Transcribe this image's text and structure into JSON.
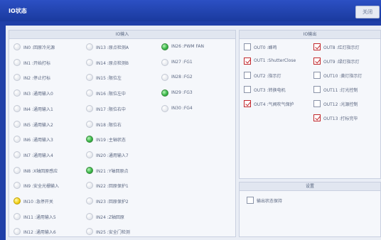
{
  "window": {
    "title": "IO状态",
    "close_label": "关闭"
  },
  "inputs_panel": {
    "title": "IO输入",
    "items": [
      {
        "label": "IN0 :回原冷光源",
        "state": "off"
      },
      {
        "label": "IN1 :开始打标",
        "state": "off"
      },
      {
        "label": "IN2 :停止打标",
        "state": "off"
      },
      {
        "label": "IN3 :通用输入0",
        "state": "off"
      },
      {
        "label": "IN4 :通用输入1",
        "state": "off"
      },
      {
        "label": "IN5 :通用输入2",
        "state": "off"
      },
      {
        "label": "IN6 :通用输入3",
        "state": "off"
      },
      {
        "label": "IN7 :通用输入4",
        "state": "off"
      },
      {
        "label": "IN8 :X轴回原感应",
        "state": "off"
      },
      {
        "label": "IN9 :安全光栅输入",
        "state": "off"
      },
      {
        "label": "IN10 :急停开关",
        "state": "yellow"
      },
      {
        "label": "IN11 :通用输入5",
        "state": "off"
      },
      {
        "label": "IN12 :通用输入6",
        "state": "off"
      },
      {
        "label": "IN13 :原点检测A",
        "state": "off"
      },
      {
        "label": "IN14 :原点检测B",
        "state": "off"
      },
      {
        "label": "IN15 :限位左",
        "state": "off"
      },
      {
        "label": "IN16 :限位左中",
        "state": "off"
      },
      {
        "label": "IN17 :限位右中",
        "state": "off"
      },
      {
        "label": "IN18 :限位右",
        "state": "off"
      },
      {
        "label": "IN19 :主轴状态",
        "state": "green"
      },
      {
        "label": "IN20 :通用输入7",
        "state": "off"
      },
      {
        "label": "IN21 :Y轴回原点",
        "state": "green"
      },
      {
        "label": "IN22 :回原保护1",
        "state": "off"
      },
      {
        "label": "IN23 :回原保护2",
        "state": "off"
      },
      {
        "label": "IN24 :Z轴回原",
        "state": "off"
      },
      {
        "label": "IN25 :安全门检测",
        "state": "off"
      },
      {
        "label": "IN26 :PWM FAN",
        "state": "green"
      },
      {
        "label": "IN27 :FG1",
        "state": "off"
      },
      {
        "label": "IN28 :FG2",
        "state": "off"
      },
      {
        "label": "IN29 :FG3",
        "state": "green"
      },
      {
        "label": "IN30 :FG4",
        "state": "off"
      }
    ]
  },
  "outputs_panel": {
    "title": "IO输出",
    "items": [
      {
        "label": "OUT0 :蜂鸣",
        "checked": false
      },
      {
        "label": "OUT1 :ShutterClose",
        "checked": true
      },
      {
        "label": "OUT2 :指示灯",
        "checked": false
      },
      {
        "label": "OUT3 :转换电机",
        "checked": false
      },
      {
        "label": "OUT4 :气阀吹气保护",
        "checked": true
      },
      {
        "label": "OUT8 :红灯指示灯",
        "checked": true
      },
      {
        "label": "OUT9 :绿灯指示灯",
        "checked": true
      },
      {
        "label": "OUT10 :黄灯指示灯",
        "checked": false
      },
      {
        "label": "OUT11 :灯光控制",
        "checked": false
      },
      {
        "label": "OUT12 :光源控制",
        "checked": false
      },
      {
        "label": "OUT13 :打标完毕",
        "checked": true
      }
    ]
  },
  "settings_panel": {
    "title": "设置",
    "option_label": "输出状态保持",
    "option_checked": false
  }
}
